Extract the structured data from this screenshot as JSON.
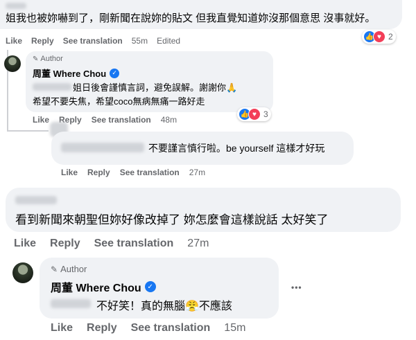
{
  "comment1": {
    "text": "姐我也被妳嚇到了，剛新聞在說妳的貼文 但我直覺知道妳沒那個意思 沒事就好。",
    "actions": {
      "like": "Like",
      "reply": "Reply",
      "translate": "See translation",
      "time": "55m",
      "edited": "Edited"
    },
    "reactions": {
      "count": "2",
      "icons": [
        "like-icon",
        "love-icon"
      ]
    }
  },
  "reply1": {
    "author_badge": "Author",
    "name": "周董 Where Chou",
    "line1": "姐日後會謹慎言詞，避免誤解。謝謝你🙏",
    "line2": "希望不要失焦，希望coco無病無痛一路好走",
    "reactions": {
      "count": "3",
      "icons": [
        "like-icon",
        "love-icon"
      ]
    },
    "actions": {
      "like": "Like",
      "reply": "Reply",
      "translate": "See translation",
      "time": "48m"
    }
  },
  "reply2": {
    "text": "不要謹言慎行啦。be yourself 這樣才好玩",
    "actions": {
      "like": "Like",
      "reply": "Reply",
      "translate": "See translation",
      "time": "27m"
    }
  },
  "comment2": {
    "text": "看到新聞來朝聖但妳好像改掉了 妳怎麼會這樣說話 太好笑了",
    "actions": {
      "like": "Like",
      "reply": "Reply",
      "translate": "See translation",
      "time": "27m"
    }
  },
  "reply3": {
    "author_badge": "Author",
    "name": "周董 Where Chou",
    "text": "不好笑！真的無腦😤不應該",
    "more": "•••",
    "actions": {
      "like": "Like",
      "reply": "Reply",
      "translate": "See translation",
      "time": "15m"
    }
  },
  "colors": {
    "bubble": "#f0f2f5",
    "accent": "#1877f2",
    "muted": "#65676b",
    "love": "#f33e58"
  }
}
